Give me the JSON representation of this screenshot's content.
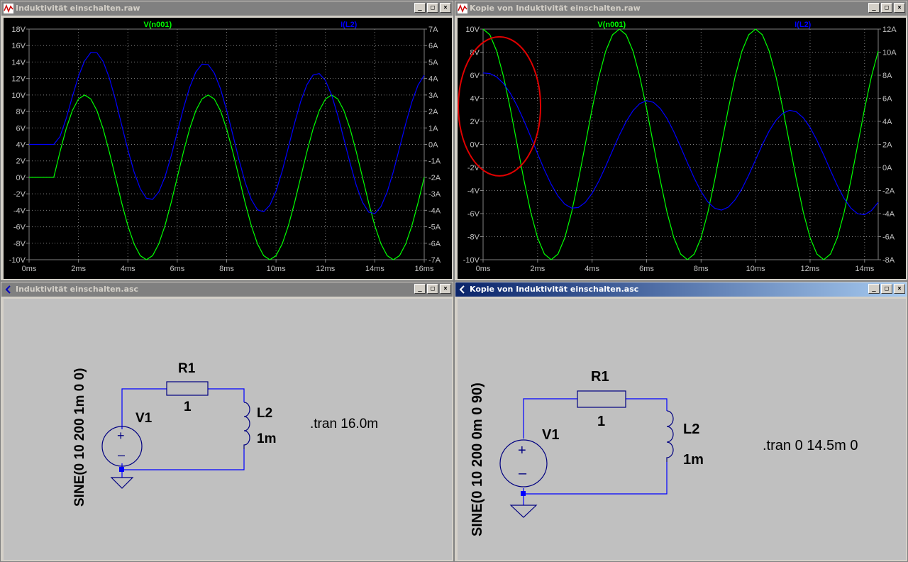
{
  "windows": {
    "plot_left": {
      "title": "Induktivität einschalten.raw",
      "traces": {
        "voltage": "V(n001)",
        "current": "I(L2)"
      },
      "left_ticks": [
        "18V",
        "16V",
        "14V",
        "12V",
        "10V",
        "8V",
        "6V",
        "4V",
        "2V",
        "0V",
        "-2V",
        "-4V",
        "-6V",
        "-8V",
        "-10V"
      ],
      "right_ticks": [
        "7A",
        "6A",
        "5A",
        "4A",
        "3A",
        "2A",
        "1A",
        "0A",
        "-1A",
        "-2A",
        "-3A",
        "-4A",
        "-5A",
        "-6A",
        "-7A"
      ],
      "x_ticks": [
        "0ms",
        "2ms",
        "4ms",
        "6ms",
        "8ms",
        "10ms",
        "12ms",
        "14ms",
        "16ms"
      ]
    },
    "plot_right": {
      "title": "Kopie von Induktivität einschalten.raw",
      "traces": {
        "voltage": "V(n001)",
        "current": "I(L2)"
      },
      "left_ticks": [
        "10V",
        "8V",
        "6V",
        "4V",
        "2V",
        "0V",
        "-2V",
        "-4V",
        "-6V",
        "-8V",
        "-10V"
      ],
      "right_ticks": [
        "12A",
        "10A",
        "8A",
        "6A",
        "4A",
        "2A",
        "0A",
        "-2A",
        "-4A",
        "-6A",
        "-8A"
      ],
      "x_ticks": [
        "0ms",
        "2ms",
        "4ms",
        "6ms",
        "8ms",
        "10ms",
        "12ms",
        "14ms"
      ]
    },
    "schem_left": {
      "title": "Induktivität einschalten.asc",
      "source_spec": "SINE(0 10 200 1m 0 0)",
      "source_name": "V1",
      "resistor_name": "R1",
      "resistor_value": "1",
      "inductor_name": "L2",
      "inductor_value": "1m",
      "directive": ".tran 16.0m"
    },
    "schem_right": {
      "title": "Kopie von Induktivität einschalten.asc",
      "source_spec": "SINE(0 10 200 0m 0 90)",
      "source_name": "V1",
      "resistor_name": "R1",
      "resistor_value": "1",
      "inductor_name": "L2",
      "inductor_value": "1m",
      "directive": ".tran 0 14.5m 0"
    }
  },
  "window_buttons": {
    "minimize": "_",
    "maximize": "□",
    "close": "×"
  },
  "chart_data": [
    {
      "type": "line",
      "x_unit": "ms",
      "xlim": [
        0,
        16
      ],
      "y_left": {
        "unit": "V",
        "lim": [
          -10,
          18
        ]
      },
      "y_right": {
        "unit": "A",
        "lim": [
          -7,
          7
        ]
      },
      "series": [
        {
          "name": "V(n001)",
          "axis": "left",
          "color": "#00ff00",
          "x": [
            0,
            1,
            1.25,
            1.5,
            1.75,
            2,
            2.25,
            2.5,
            2.75,
            3,
            3.25,
            3.5,
            3.75,
            4,
            4.25,
            4.5,
            4.75,
            5,
            5.25,
            5.5,
            5.75,
            6,
            6.25,
            6.5,
            6.75,
            7,
            7.25,
            7.5,
            7.75,
            8,
            8.25,
            8.5,
            8.75,
            9,
            9.25,
            9.5,
            9.75,
            10,
            10.25,
            10.5,
            10.75,
            11,
            11.25,
            11.5,
            11.75,
            12,
            12.25,
            12.5,
            12.75,
            13,
            13.25,
            13.5,
            13.75,
            14,
            14.25,
            14.5,
            14.75,
            15,
            15.25,
            15.5,
            15.75,
            16
          ],
          "y": [
            0,
            0,
            3.09,
            5.88,
            8.09,
            9.51,
            10,
            9.51,
            8.09,
            5.88,
            3.09,
            0,
            -3.09,
            -5.88,
            -8.09,
            -9.51,
            -10,
            -9.51,
            -8.09,
            -5.88,
            -3.09,
            0,
            3.09,
            5.88,
            8.09,
            9.51,
            10,
            9.51,
            8.09,
            5.88,
            3.09,
            0,
            -3.09,
            -5.88,
            -8.09,
            -9.51,
            -10,
            -9.51,
            -8.09,
            -5.88,
            -3.09,
            0,
            3.09,
            5.88,
            8.09,
            9.51,
            10,
            9.51,
            8.09,
            5.88,
            3.09,
            0,
            -3.09,
            -5.88,
            -8.09,
            -9.51,
            -10,
            -9.51,
            -8.09,
            -5.88,
            -3.09,
            0
          ]
        },
        {
          "name": "I(L2)",
          "axis": "right",
          "color": "#0000ff",
          "x": [
            0,
            1,
            1.25,
            1.5,
            1.75,
            2,
            2.25,
            2.5,
            2.75,
            3,
            3.25,
            3.5,
            3.75,
            4,
            4.25,
            4.5,
            4.75,
            5,
            5.25,
            5.5,
            5.75,
            6,
            6.25,
            6.5,
            6.75,
            7,
            7.25,
            7.5,
            7.75,
            8,
            8.25,
            8.5,
            8.75,
            9,
            9.25,
            9.5,
            9.75,
            10,
            10.25,
            10.5,
            10.75,
            11,
            11.25,
            11.5,
            11.75,
            12,
            12.25,
            12.5,
            12.75,
            13,
            13.25,
            13.5,
            13.75,
            14,
            14.25,
            14.5,
            14.75,
            15,
            15.25,
            15.5,
            15.75,
            16
          ],
          "y": [
            0,
            0,
            0.47,
            1.55,
            2.88,
            4.13,
            5.07,
            5.58,
            5.56,
            5.03,
            4.04,
            2.7,
            1.18,
            -0.33,
            -1.67,
            -2.69,
            -3.27,
            -3.34,
            -2.89,
            -1.98,
            -0.71,
            0.74,
            2.19,
            3.46,
            4.39,
            4.87,
            4.85,
            4.33,
            3.38,
            2.07,
            0.59,
            -0.93,
            -2.3,
            -3.35,
            -3.97,
            -4.09,
            -3.69,
            -2.84,
            -1.62,
            -0.18,
            1.28,
            2.61,
            3.62,
            4.21,
            4.3,
            3.88,
            2.99,
            1.75,
            0.31,
            -1.15,
            -2.49,
            -3.51,
            -4.11,
            -4.2,
            -3.77,
            -2.89,
            -1.65,
            -0.21,
            1.25,
            2.58,
            3.6,
            4.19
          ]
        }
      ]
    },
    {
      "type": "line",
      "x_unit": "ms",
      "xlim": [
        0,
        14.5
      ],
      "y_left": {
        "unit": "V",
        "lim": [
          -10,
          10
        ]
      },
      "y_right": {
        "unit": "A",
        "lim": [
          -8,
          12
        ]
      },
      "series": [
        {
          "name": "V(n001)",
          "axis": "left",
          "color": "#00ff00",
          "x": [
            0,
            0.25,
            0.5,
            0.75,
            1,
            1.25,
            1.5,
            1.75,
            2,
            2.25,
            2.5,
            2.75,
            3,
            3.25,
            3.5,
            3.75,
            4,
            4.25,
            4.5,
            4.75,
            5,
            5.25,
            5.5,
            5.75,
            6,
            6.25,
            6.5,
            6.75,
            7,
            7.25,
            7.5,
            7.75,
            8,
            8.25,
            8.5,
            8.75,
            9,
            9.25,
            9.5,
            9.75,
            10,
            10.25,
            10.5,
            10.75,
            11,
            11.25,
            11.5,
            11.75,
            12,
            12.25,
            12.5,
            12.75,
            13,
            13.25,
            13.5,
            13.75,
            14,
            14.25,
            14.5
          ],
          "y": [
            10,
            9.51,
            8.09,
            5.88,
            3.09,
            0,
            -3.09,
            -5.88,
            -8.09,
            -9.51,
            -10,
            -9.51,
            -8.09,
            -5.88,
            -3.09,
            0,
            3.09,
            5.88,
            8.09,
            9.51,
            10,
            9.51,
            8.09,
            5.88,
            3.09,
            0,
            -3.09,
            -5.88,
            -8.09,
            -9.51,
            -10,
            -9.51,
            -8.09,
            -5.88,
            -3.09,
            0,
            3.09,
            5.88,
            8.09,
            9.51,
            10,
            9.51,
            8.09,
            5.88,
            3.09,
            0,
            -3.09,
            -5.88,
            -8.09,
            -9.51,
            -10,
            -9.51,
            -8.09,
            -5.88,
            -3.09,
            0,
            3.09,
            5.88,
            8.09
          ]
        },
        {
          "name": "I(L2)",
          "axis": "right",
          "color": "#0000ff",
          "x": [
            0,
            0.25,
            0.5,
            0.75,
            1,
            1.25,
            1.5,
            1.75,
            2,
            2.25,
            2.5,
            2.75,
            3,
            3.25,
            3.5,
            3.75,
            4,
            4.25,
            4.5,
            4.75,
            5,
            5.25,
            5.5,
            5.75,
            6,
            6.25,
            6.5,
            6.75,
            7,
            7.25,
            7.5,
            7.75,
            8,
            8.25,
            8.5,
            8.75,
            9,
            9.25,
            9.5,
            9.75,
            10,
            10.25,
            10.5,
            10.75,
            11,
            11.25,
            11.5,
            11.75,
            12,
            12.25,
            12.5,
            12.75,
            13,
            13.25,
            13.5,
            13.75,
            14,
            14.25,
            14.5
          ],
          "y": [
            8.2,
            8.15,
            7.85,
            7.28,
            6.43,
            5.35,
            4.06,
            2.66,
            1.2,
            -0.21,
            -1.46,
            -2.48,
            -3.19,
            -3.52,
            -3.47,
            -3.03,
            -2.24,
            -1.17,
            0.11,
            1.47,
            2.8,
            3.98,
            4.92,
            5.54,
            5.79,
            5.65,
            5.12,
            4.25,
            3.1,
            1.78,
            0.4,
            -0.93,
            -2.09,
            -2.99,
            -3.54,
            -3.7,
            -3.44,
            -2.8,
            -1.85,
            -0.66,
            0.66,
            1.98,
            3.16,
            4.09,
            4.71,
            4.96,
            4.82,
            4.31,
            3.47,
            2.36,
            1.08,
            -0.27,
            -1.57,
            -2.7,
            -3.54,
            -4.02,
            -4.09,
            -3.74,
            -3.02
          ]
        }
      ]
    }
  ]
}
